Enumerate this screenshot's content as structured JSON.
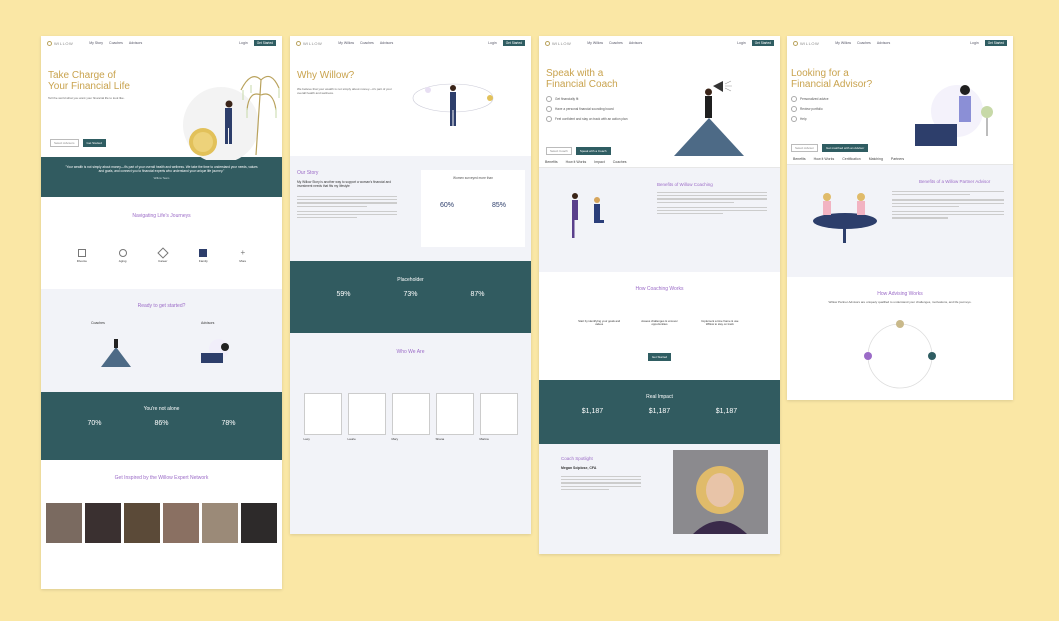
{
  "colors": {
    "background": "#fae7a5",
    "teal": "#315b60",
    "gold": "#c9a34e",
    "purple": "#9b6bc7"
  },
  "p1": {
    "nav": [
      "My Story",
      "Coaches",
      "Advisors"
    ],
    "login": "Login",
    "cta": "Get Started",
    "logo": "WILLOW",
    "hero_title_1": "Take Charge of",
    "hero_title_2": "Your Financial Life",
    "hero_sub": "Tell the world what you want your financial life to look like.",
    "select": "Select Advisors",
    "button": "Get Started",
    "quote": "\"Your wealth is not simply about money—it's part of your overall health and wellness. We take the time to understand your needs, values and goals, and connect you to financial experts who understand your unique life journey.\"",
    "quote_author": "Willow Team",
    "journeys_title": "Navigating Life's Journeys",
    "journeys_icons": [
      "Divorce",
      "Aging",
      "Career",
      "Family",
      "More"
    ],
    "ready_title": "Ready to get started?",
    "coaches_label": "Coaches",
    "advisors_label": "Advisors",
    "not_alone_title": "You're not alone",
    "stats": [
      "70%",
      "86%",
      "78%"
    ],
    "inspired_title": "Get Inspired by the Willow Expert Network"
  },
  "p2": {
    "nav": [
      "My Willow",
      "Coaches",
      "Advisors"
    ],
    "login": "Login",
    "cta": "Get Started",
    "logo": "WILLOW",
    "hero_title": "Why Willow?",
    "hero_sub": "We believe that your wealth is not simply about money—it's part of your overall health and wellness.",
    "story_title": "Our Story",
    "story_lead": "My Willow Story is another way to support a woman's financial and investment needs that fits my lifestyle",
    "stats_title": "Women surveyed more than",
    "stat1": "60%",
    "stat2": "85%",
    "band_title": "Placeholder",
    "band_stats": [
      "59%",
      "73%",
      "87%"
    ],
    "who_title": "Who We Are",
    "people": [
      "Lacy",
      "Laurie",
      "Mary",
      "Shana",
      "Marina"
    ]
  },
  "p3": {
    "nav": [
      "My Willow",
      "Coaches",
      "Advisors"
    ],
    "login": "Login",
    "cta": "Get Started",
    "logo": "WILLOW",
    "hero_title_1": "Speak with a",
    "hero_title_2": "Financial Coach",
    "bullets": [
      "Get financially fit",
      "Have a personal financial sounding board",
      "Feel confident and stay on track with an action plan"
    ],
    "select": "Select Coach",
    "button": "Speak with a Coach",
    "tabs": [
      "Benefits",
      "How it Works",
      "Impact",
      "Coaches"
    ],
    "benefits_title": "Benefits of Willow Coaching",
    "how_title": "How Coaching Works",
    "how_steps": [
      "Start by identifying your goals and values",
      "Assess challenges & uncover opportunities",
      "Implement a time frame & use Willow to stay on track"
    ],
    "how_button": "Get Started",
    "impact_title": "Real Impact",
    "impact_values": [
      "$1,187",
      "$1,187",
      "$1,187"
    ],
    "impact_label": "Savings",
    "spotlight_title": "Coach Spotlight",
    "spotlight_name": "Megan Sciplose, CFA"
  },
  "p4": {
    "nav": [
      "My Willow",
      "Coaches",
      "Advisors"
    ],
    "login": "Login",
    "cta": "Get Started",
    "logo": "WILLOW",
    "hero_title_1": "Looking for a",
    "hero_title_2": "Financial Advisor?",
    "bullets": [
      "Personalized advice",
      "Review portfolio",
      "Help"
    ],
    "select": "Select Advisor",
    "button": "Get matched with an Advisor",
    "tabs": [
      "Benefits",
      "How it Works",
      "Certification",
      "Matching",
      "Partners"
    ],
    "benefits_title": "Benefits of a Willow Partner Advisor",
    "how_title": "How Advising Works",
    "how_sub": "Willow Partner Advisors are uniquely qualified to understand your challenges, motivations, and life journeys."
  }
}
